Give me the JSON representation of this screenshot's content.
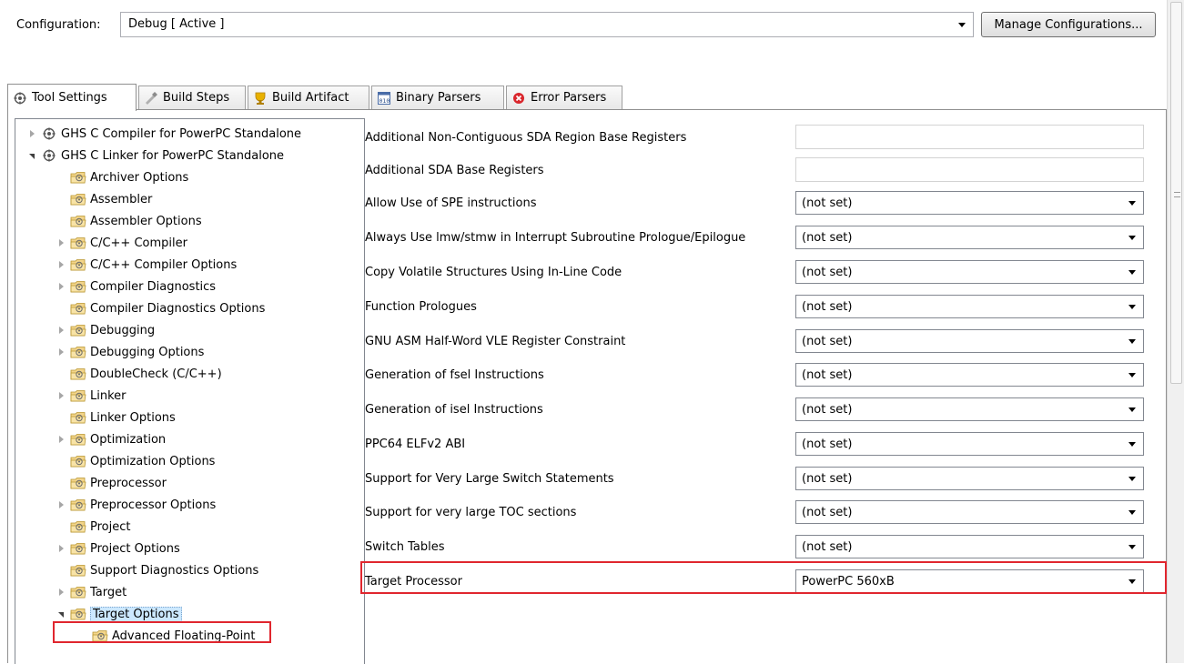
{
  "config": {
    "label": "Configuration:",
    "value": "Debug  [ Active ]",
    "manage_label": "Manage Configurations..."
  },
  "tabs": [
    {
      "label": "Tool Settings",
      "icon": "tool-settings-icon",
      "active": true
    },
    {
      "label": "Build Steps",
      "icon": "build-steps-icon",
      "active": false
    },
    {
      "label": "Build Artifact",
      "icon": "build-artifact-icon",
      "active": false
    },
    {
      "label": "Binary Parsers",
      "icon": "binary-parsers-icon",
      "active": false
    },
    {
      "label": "Error Parsers",
      "icon": "error-parsers-icon",
      "active": false
    }
  ],
  "tree": {
    "items": [
      {
        "label": "GHS C Compiler for PowerPC Standalone",
        "level": 0,
        "expander": "closed",
        "icon": "tool-gear-icon"
      },
      {
        "label": "GHS C Linker for PowerPC Standalone",
        "level": 0,
        "expander": "open",
        "icon": "tool-gear-icon"
      },
      {
        "label": "Archiver Options",
        "level": 1,
        "expander": "none",
        "icon": "option-folder-icon"
      },
      {
        "label": "Assembler",
        "level": 1,
        "expander": "none",
        "icon": "option-folder-icon"
      },
      {
        "label": "Assembler Options",
        "level": 1,
        "expander": "none",
        "icon": "option-folder-icon"
      },
      {
        "label": "C/C++ Compiler",
        "level": 1,
        "expander": "closed",
        "icon": "option-folder-icon"
      },
      {
        "label": "C/C++ Compiler Options",
        "level": 1,
        "expander": "closed",
        "icon": "option-folder-icon"
      },
      {
        "label": "Compiler Diagnostics",
        "level": 1,
        "expander": "closed",
        "icon": "option-folder-icon"
      },
      {
        "label": "Compiler Diagnostics Options",
        "level": 1,
        "expander": "none",
        "icon": "option-folder-icon"
      },
      {
        "label": "Debugging",
        "level": 1,
        "expander": "closed",
        "icon": "option-folder-icon"
      },
      {
        "label": "Debugging Options",
        "level": 1,
        "expander": "closed",
        "icon": "option-folder-icon"
      },
      {
        "label": "DoubleCheck (C/C++)",
        "level": 1,
        "expander": "none",
        "icon": "option-folder-icon"
      },
      {
        "label": "Linker",
        "level": 1,
        "expander": "closed",
        "icon": "option-folder-icon"
      },
      {
        "label": "Linker Options",
        "level": 1,
        "expander": "none",
        "icon": "option-folder-icon"
      },
      {
        "label": "Optimization",
        "level": 1,
        "expander": "closed",
        "icon": "option-folder-icon"
      },
      {
        "label": "Optimization Options",
        "level": 1,
        "expander": "none",
        "icon": "option-folder-icon"
      },
      {
        "label": "Preprocessor",
        "level": 1,
        "expander": "none",
        "icon": "option-folder-icon"
      },
      {
        "label": "Preprocessor Options",
        "level": 1,
        "expander": "closed",
        "icon": "option-folder-icon"
      },
      {
        "label": "Project",
        "level": 1,
        "expander": "none",
        "icon": "option-folder-icon"
      },
      {
        "label": "Project Options",
        "level": 1,
        "expander": "closed",
        "icon": "option-folder-icon"
      },
      {
        "label": "Support Diagnostics Options",
        "level": 1,
        "expander": "none",
        "icon": "option-folder-icon"
      },
      {
        "label": "Target",
        "level": 1,
        "expander": "closed",
        "icon": "option-folder-icon"
      },
      {
        "label": "Target Options",
        "level": 1,
        "expander": "open",
        "icon": "option-folder-icon",
        "selected": true
      },
      {
        "label": "Advanced Floating-Point",
        "level": 2,
        "expander": "none",
        "icon": "option-folder-icon"
      }
    ]
  },
  "options": [
    {
      "label": "Additional Non-Contiguous SDA Region Base Registers",
      "type": "text",
      "value": ""
    },
    {
      "label": "Additional SDA Base Registers",
      "type": "text",
      "value": ""
    },
    {
      "label": "Allow Use of SPE instructions",
      "type": "select",
      "value": "(not set)"
    },
    {
      "label": "Always Use lmw/stmw in Interrupt Subroutine Prologue/Epilogue",
      "type": "select",
      "value": "(not set)"
    },
    {
      "label": "Copy Volatile Structures Using In-Line Code",
      "type": "select",
      "value": "(not set)"
    },
    {
      "label": "Function Prologues",
      "type": "select",
      "value": "(not set)"
    },
    {
      "label": "GNU ASM Half-Word VLE Register Constraint",
      "type": "select",
      "value": "(not set)"
    },
    {
      "label": "Generation of fsel Instructions",
      "type": "select",
      "value": "(not set)"
    },
    {
      "label": "Generation of isel Instructions",
      "type": "select",
      "value": "(not set)"
    },
    {
      "label": "PPC64 ELFv2 ABI",
      "type": "select",
      "value": "(not set)"
    },
    {
      "label": "Support for Very Large Switch Statements",
      "type": "select",
      "value": "(not set)"
    },
    {
      "label": "Support for very large TOC sections",
      "type": "select",
      "value": "(not set)"
    },
    {
      "label": "Switch Tables",
      "type": "select",
      "value": "(not set)"
    },
    {
      "label": "Target Processor",
      "type": "select",
      "value": "PowerPC 560xB",
      "highlighted": true
    }
  ],
  "colors": {
    "highlight_box": "#e0262e",
    "selection": "#cce8ff",
    "error_icon": "#d9262c",
    "artifact_icon": "#e8b100"
  }
}
